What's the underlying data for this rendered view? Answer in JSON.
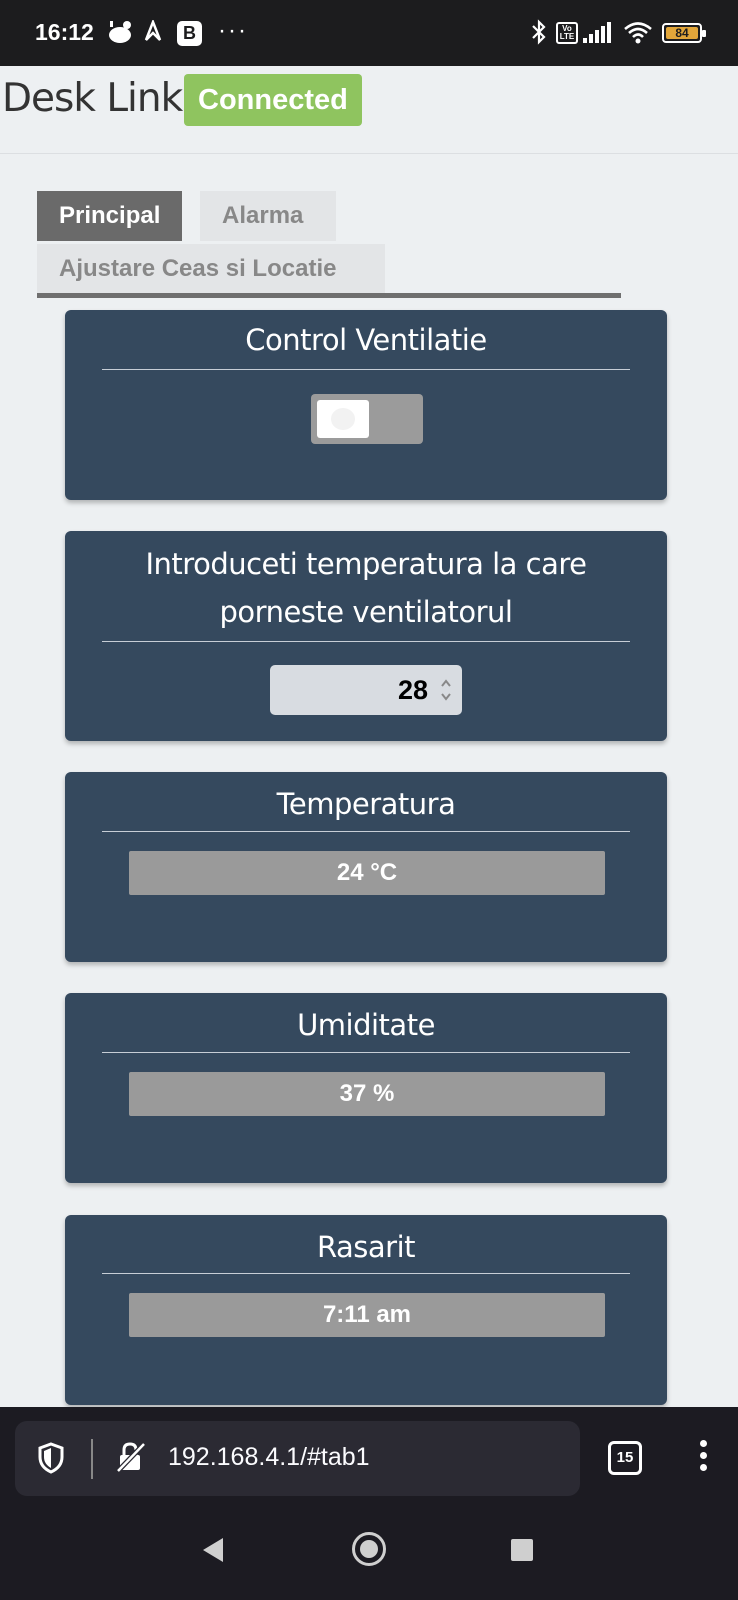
{
  "status_bar": {
    "time": "16:12",
    "notification_b": "B",
    "more": "···",
    "lte_top": "Vo",
    "lte_bottom": "LTE",
    "battery": "84",
    "icons": [
      "weather-icon",
      "arrow-icon",
      "b-app-icon",
      "bluetooth-icon",
      "volte-icon",
      "signal-icon",
      "wifi-icon",
      "battery-icon"
    ]
  },
  "header": {
    "title": "Desk Link",
    "status": "Connected",
    "status_color": "#8fc45f"
  },
  "tabs": [
    {
      "label": "Principal",
      "active": true
    },
    {
      "label": "Alarma",
      "active": false
    },
    {
      "label": "Ajustare Ceas si Locatie",
      "active": false
    }
  ],
  "cards": {
    "ventilation": {
      "title": "Control Ventilatie",
      "toggle_on": false
    },
    "threshold": {
      "title_line1": "Introduceti temperatura la care",
      "title_line2": "porneste ventilatorul",
      "value": "28"
    },
    "temperature": {
      "title": "Temperatura",
      "value": "24 °C"
    },
    "humidity": {
      "title": "Umiditate",
      "value": "37 %"
    },
    "sunrise": {
      "title": "Rasarit",
      "value": "7:11 am"
    }
  },
  "browser": {
    "url": "192.168.4.1/#tab1",
    "tab_count": "15"
  },
  "colors": {
    "card_bg": "#35495e",
    "page_bg": "#edf0f2",
    "value_bar": "#9a9a9a"
  }
}
